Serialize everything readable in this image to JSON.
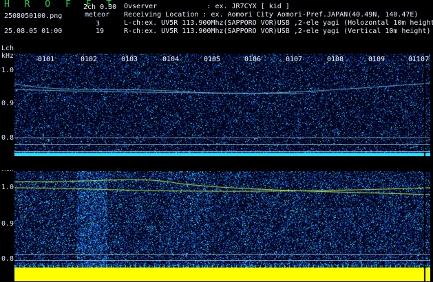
{
  "header": {
    "brand": "H R O F F T",
    "filename": "2508050100.png",
    "timestamp": "25.08.05 01:00",
    "channel_mode": "2ch 0.30",
    "meteor_label": "meteor",
    "meteor_left": "3",
    "meteor_right": "19",
    "observer": "Ovserver            : ex. JR7CYX [ kid ]",
    "location": "Receiving Location : ex. Aomori City Aomori-Pref.JAPAN(40.49N, 140.47E)",
    "lch_desc": "L-ch:ex. UV5R 113.900Mhz(SAPPORO VOR)USB ,2-ele yagi (Holozontal 10m height",
    "rch_desc": "R-ch:ex. UV5R 113.900Mhz(SAPPORO VOR)USB ,2-ele yagi (Vertical 10m height)"
  },
  "left_panel": {
    "channel": "Lch",
    "unit": "kHz",
    "ticks": [
      "1.0",
      "0.9",
      "0.8"
    ],
    "time_labels": [
      "0101",
      "0102",
      "0103",
      "0104",
      "0105",
      "0106",
      "0107",
      "0108",
      "0109",
      "01107"
    ]
  },
  "right_panel": {
    "channel": "Rch",
    "ticks": [
      "1.0",
      "0.9",
      "0.8"
    ]
  },
  "colors": {
    "background": "#000000",
    "brand": "#19d84a",
    "noise_low": "#102c88",
    "noise_mid": "#1d65e0",
    "noise_high": "#20e0ff",
    "signal": "#d7ff4a",
    "ground": "#ffff00"
  }
}
